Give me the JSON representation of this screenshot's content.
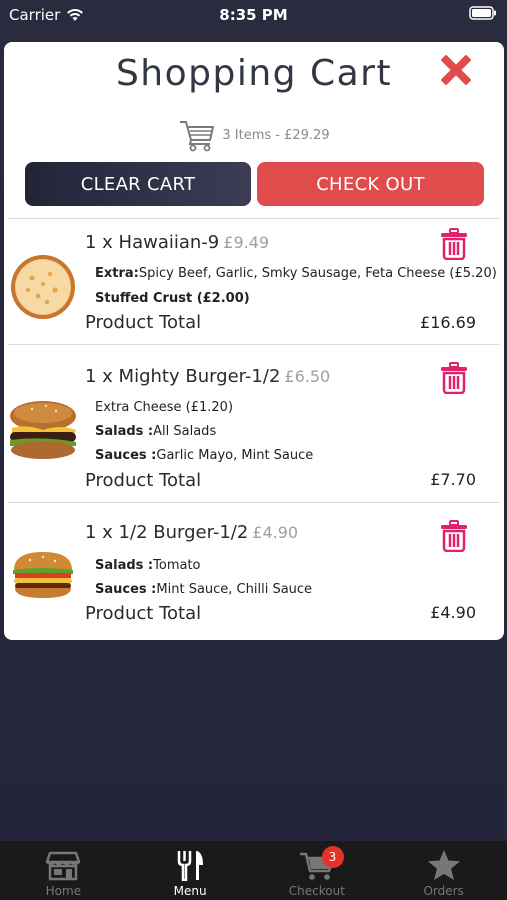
{
  "status_bar": {
    "carrier": "Carrier",
    "time": "8:35 PM"
  },
  "cart": {
    "title": "Shopping Cart",
    "summary": "3 Items - £29.29",
    "clear_label": "CLEAR CART",
    "checkout_label": "CHECK OUT",
    "items": [
      {
        "name": "1 x Hawaiian-9",
        "price": "£9.49",
        "lines": [
          {
            "label": "Extra:",
            "value": "Spicy Beef, Garlic, Smky Sausage, Feta Cheese (£5.20)"
          },
          {
            "label": "Stuffed Crust (£2.00)",
            "value": ""
          }
        ],
        "total_label": "Product Total",
        "total": "£16.69",
        "image_icon": "pizza-icon"
      },
      {
        "name": "1 x Mighty Burger-1/2",
        "price": "£6.50",
        "lines": [
          {
            "label": "",
            "value": "Extra Cheese (£1.20)"
          },
          {
            "label": "Salads :",
            "value": "All Salads"
          },
          {
            "label": "Sauces :",
            "value": "Garlic Mayo, Mint Sauce"
          }
        ],
        "total_label": "Product Total",
        "total": "£7.70",
        "image_icon": "burger-icon"
      },
      {
        "name": "1 x 1/2 Burger-1/2",
        "price": "£4.90",
        "lines": [
          {
            "label": "Salads :",
            "value": "Tomato"
          },
          {
            "label": "Sauces :",
            "value": "Mint Sauce, Chilli Sauce"
          }
        ],
        "total_label": "Product Total",
        "total": "£4.90",
        "image_icon": "burger-icon"
      }
    ]
  },
  "tabs": [
    {
      "label": "Home",
      "icon": "store-icon"
    },
    {
      "label": "Menu",
      "icon": "cutlery-icon",
      "active": true
    },
    {
      "label": "Checkout",
      "icon": "cart-icon",
      "badge": "3"
    },
    {
      "label": "Orders",
      "icon": "star-icon"
    }
  ],
  "colors": {
    "accent_red": "#e04b4b",
    "trash_pink": "#e0226e",
    "dark": "#24253a"
  }
}
